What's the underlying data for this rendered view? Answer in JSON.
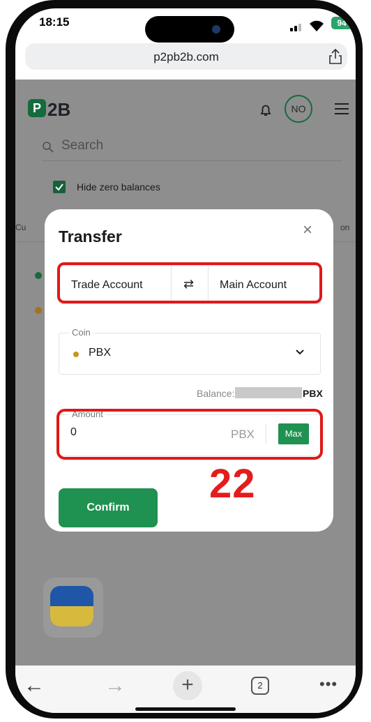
{
  "status_bar": {
    "time": "18:15",
    "battery": "94"
  },
  "browser": {
    "url": "p2pb2b.com"
  },
  "site": {
    "logo_mark": "P",
    "logo_text": "2B",
    "avatar_initials": "NO",
    "search_placeholder": "Search",
    "hide_zero_label": "Hide zero balances",
    "col_left_fragment": "Cu",
    "col_right_fragment": "on"
  },
  "modal": {
    "title": "Transfer",
    "close_symbol": "×",
    "from_account": "Trade Account",
    "swap_symbol": "⇄",
    "to_account": "Main Account",
    "coin_label": "Coin",
    "coin_value": "PBX",
    "balance_label": "Balance:",
    "balance_unit": "PBX",
    "amount_label": "Amount",
    "amount_value": "0",
    "amount_unit": "PBX",
    "max_label": "Max",
    "confirm_label": "Confirm"
  },
  "annotation": {
    "number": "22",
    "color": "#e41c1c"
  },
  "bottom_nav": {
    "back_symbol": "←",
    "forward_symbol": "→",
    "new_tab_symbol": "+",
    "tab_count": "2",
    "more_symbol": "•••"
  },
  "colors": {
    "brand_green": "#1f9150",
    "highlight_red": "#e01818",
    "overlay_gray": "#8e8e8e"
  }
}
